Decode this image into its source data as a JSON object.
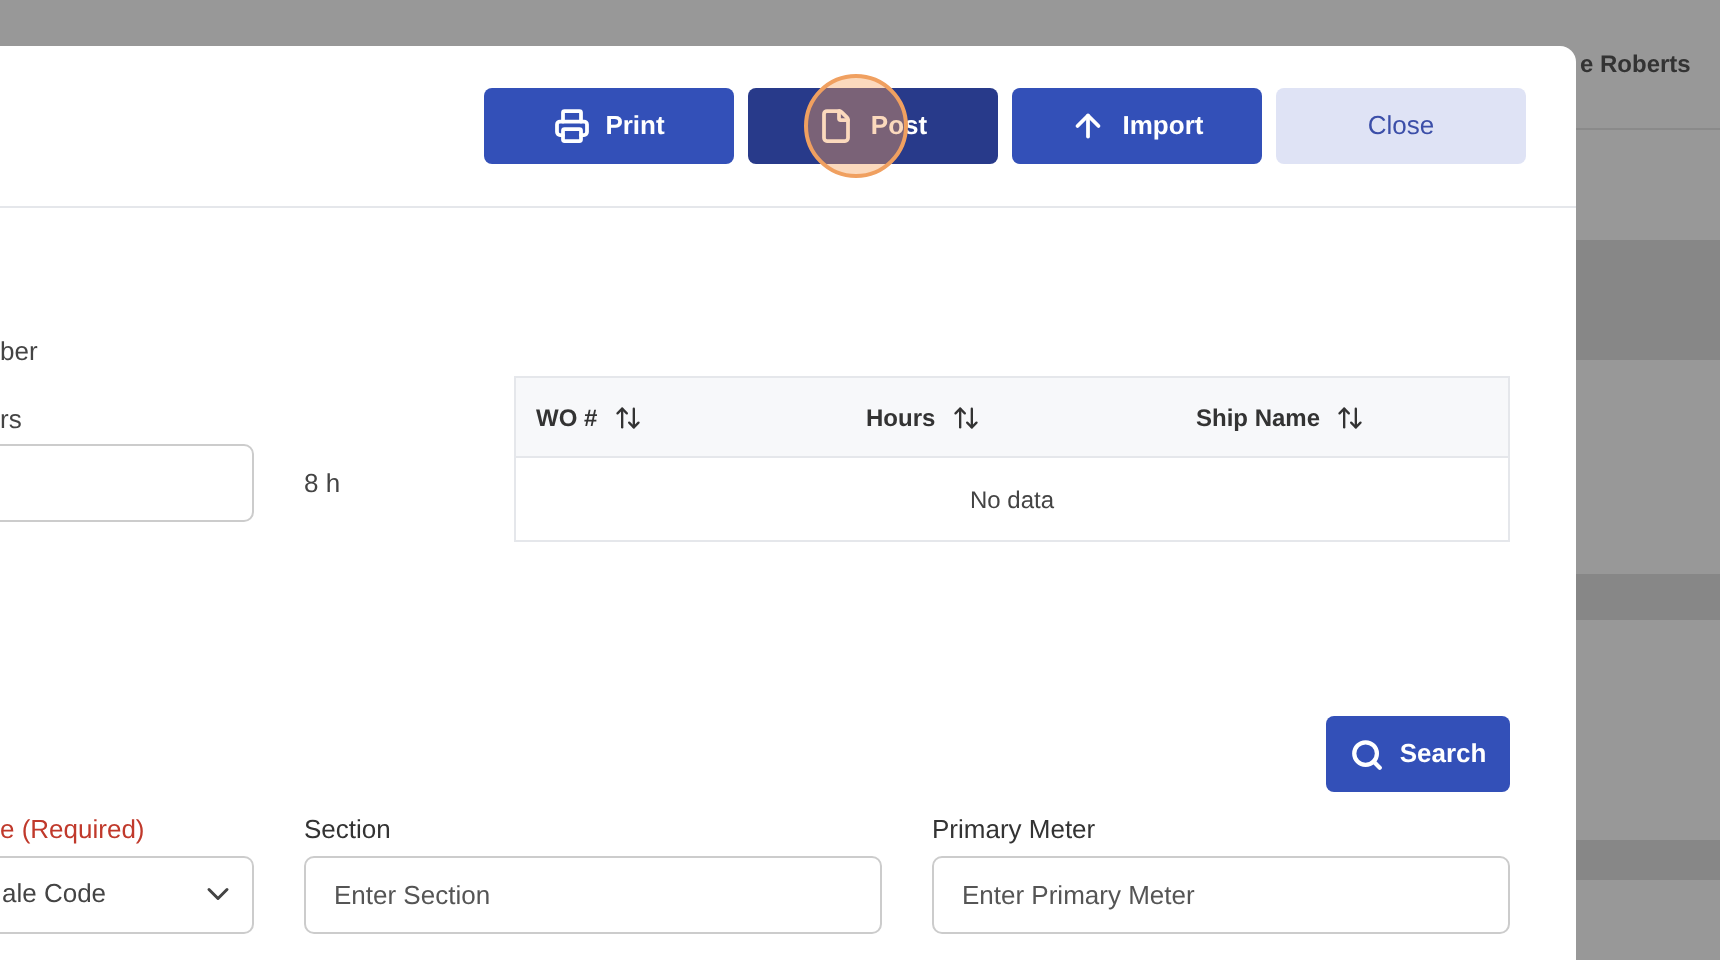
{
  "background": {
    "user_name": "e Roberts"
  },
  "toolbar": {
    "buttons": [
      {
        "label": "Print",
        "kind": "print",
        "hovered": false
      },
      {
        "label": "Post",
        "kind": "post",
        "hovered": true
      },
      {
        "label": "Import",
        "kind": "import",
        "hovered": false
      },
      {
        "label": "Close",
        "kind": "close",
        "hovered": false
      }
    ]
  },
  "form": {
    "number_label": "ber",
    "hours_label": "rs",
    "hours_unit": "8 h"
  },
  "table": {
    "columns": [
      "WO #",
      "Hours",
      "Ship Name"
    ],
    "empty_text": "No data"
  },
  "search_button": "Search",
  "filters": [
    {
      "label": "e (Required)",
      "required": true,
      "kind": "select",
      "value": "ale Code"
    },
    {
      "label": "Section",
      "required": false,
      "kind": "input",
      "placeholder": "Enter Section"
    },
    {
      "label": "Primary Meter",
      "required": false,
      "kind": "input",
      "placeholder": "Enter Primary Meter"
    }
  ]
}
